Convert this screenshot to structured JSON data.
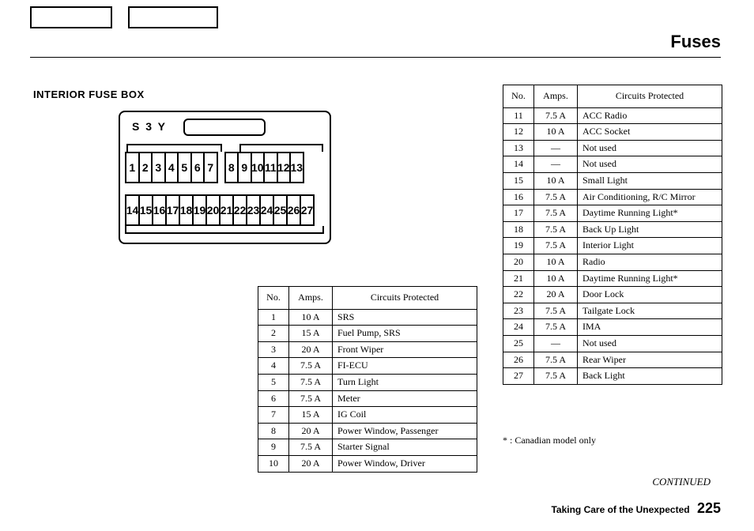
{
  "page_title": "Fuses",
  "section_title": "INTERIOR FUSE BOX",
  "fusebox_code": "S 3 Y",
  "fusebox_row1": [
    "1",
    "2",
    "3",
    "4",
    "5",
    "6",
    "7",
    "",
    "8",
    "9",
    "10",
    "11",
    "12",
    "13"
  ],
  "fusebox_row2": [
    "14",
    "15",
    "16",
    "17",
    "18",
    "19",
    "20",
    "21",
    "22",
    "23",
    "24",
    "25",
    "26",
    "27"
  ],
  "table_headers": {
    "no": "No.",
    "amps": "Amps.",
    "circ": "Circuits Protected"
  },
  "table_left": [
    {
      "no": "1",
      "amps": "10 A",
      "circ": "SRS"
    },
    {
      "no": "2",
      "amps": "15 A",
      "circ": "Fuel Pump, SRS"
    },
    {
      "no": "3",
      "amps": "20 A",
      "circ": "Front Wiper"
    },
    {
      "no": "4",
      "amps": "7.5 A",
      "circ": "FI-ECU"
    },
    {
      "no": "5",
      "amps": "7.5 A",
      "circ": "Turn Light"
    },
    {
      "no": "6",
      "amps": "7.5 A",
      "circ": "Meter"
    },
    {
      "no": "7",
      "amps": "15 A",
      "circ": "IG Coil"
    },
    {
      "no": "8",
      "amps": "20 A",
      "circ": "Power Window, Passenger"
    },
    {
      "no": "9",
      "amps": "7.5 A",
      "circ": "Starter Signal"
    },
    {
      "no": "10",
      "amps": "20 A",
      "circ": "Power Window, Driver"
    }
  ],
  "table_right": [
    {
      "no": "11",
      "amps": "7.5 A",
      "circ": "ACC Radio"
    },
    {
      "no": "12",
      "amps": "10 A",
      "circ": "ACC Socket"
    },
    {
      "no": "13",
      "amps": "—",
      "circ": "Not used"
    },
    {
      "no": "14",
      "amps": "—",
      "circ": "Not used"
    },
    {
      "no": "15",
      "amps": "10 A",
      "circ": "Small Light"
    },
    {
      "no": "16",
      "amps": "7.5 A",
      "circ": "Air Conditioning, R/C Mirror"
    },
    {
      "no": "17",
      "amps": "7.5 A",
      "circ": "Daytime Running Light*"
    },
    {
      "no": "18",
      "amps": "7.5 A",
      "circ": "Back Up Light"
    },
    {
      "no": "19",
      "amps": "7.5 A",
      "circ": "Interior Light"
    },
    {
      "no": "20",
      "amps": "10 A",
      "circ": "Radio"
    },
    {
      "no": "21",
      "amps": "10 A",
      "circ": "Daytime Running Light*"
    },
    {
      "no": "22",
      "amps": "20 A",
      "circ": "Door Lock"
    },
    {
      "no": "23",
      "amps": "7.5 A",
      "circ": "Tailgate Lock"
    },
    {
      "no": "24",
      "amps": "7.5 A",
      "circ": "IMA"
    },
    {
      "no": "25",
      "amps": "—",
      "circ": "Not used"
    },
    {
      "no": "26",
      "amps": "7.5 A",
      "circ": "Rear Wiper"
    },
    {
      "no": "27",
      "amps": "7.5 A",
      "circ": "Back Light"
    }
  ],
  "footnote": "* : Canadian model only",
  "continued": "CONTINUED",
  "footer_section": "Taking Care of the Unexpected",
  "page_number": "225"
}
